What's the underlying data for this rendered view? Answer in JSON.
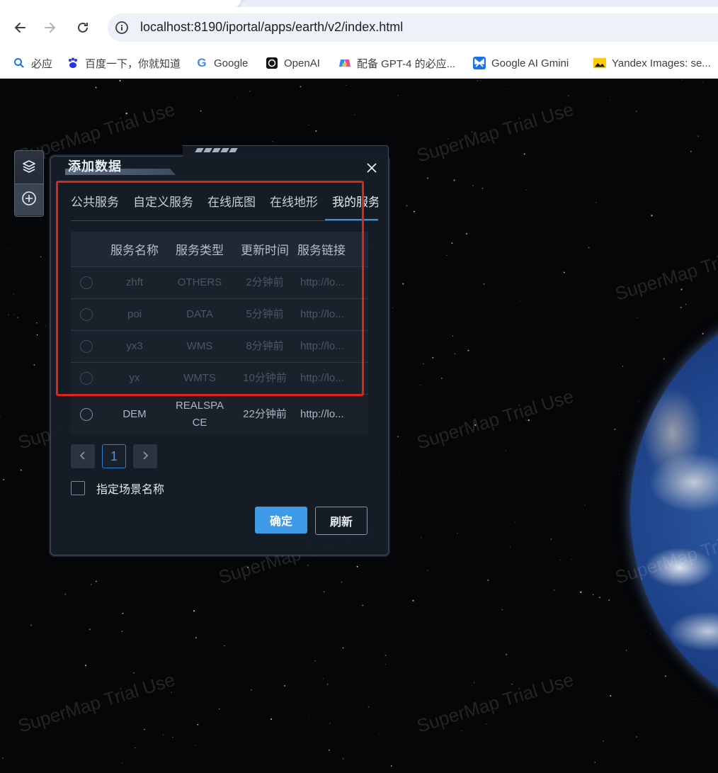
{
  "browser": {
    "url": "localhost:8190/iportal/apps/earth/v2/index.html",
    "bookmarks": [
      {
        "label": "必应",
        "icon": "search-icon"
      },
      {
        "label": "百度一下，你就知道",
        "icon": "baidu-paw-icon"
      },
      {
        "label": "Google",
        "icon": "google-g-icon"
      },
      {
        "label": "OpenAI",
        "icon": "openai-icon"
      },
      {
        "label": "配备 GPT-4 的必应...",
        "icon": "copilot-icon"
      },
      {
        "label": "Google AI Gmini",
        "icon": "butterfly-icon"
      },
      {
        "label": "Yandex Images: se...",
        "icon": "image-icon"
      }
    ]
  },
  "watermark": "SuperMap Trial Use",
  "dialog": {
    "title": "添加数据",
    "tabs": [
      "公共服务",
      "自定义服务",
      "在线底图",
      "在线地形",
      "我的服务"
    ],
    "active_tab": "我的服务",
    "columns": [
      "服务名称",
      "服务类型",
      "更新时间",
      "服务链接"
    ],
    "rows": [
      {
        "name": "zhft",
        "type": "OTHERS",
        "time": "2分钟前",
        "link": "http://lo..."
      },
      {
        "name": "poi",
        "type": "DATA",
        "time": "5分钟前",
        "link": "http://lo..."
      },
      {
        "name": "yx3",
        "type": "WMS",
        "time": "8分钟前",
        "link": "http://lo..."
      },
      {
        "name": "yx",
        "type": "WMTS",
        "time": "10分钟前",
        "link": "http://lo..."
      },
      {
        "name": "DEM",
        "type": "REALSPACE",
        "type_line1": "REALSPA",
        "type_line2": "CE",
        "time": "22分钟前",
        "link": "http://lo..."
      }
    ],
    "pager": {
      "prev": "‹",
      "current": "1",
      "next": "›"
    },
    "scene_name_label": "指定场景名称",
    "ok_label": "确定",
    "refresh_label": "刷新"
  },
  "colors": {
    "accent": "#3f9ae8",
    "highlight": "#e0241c"
  }
}
